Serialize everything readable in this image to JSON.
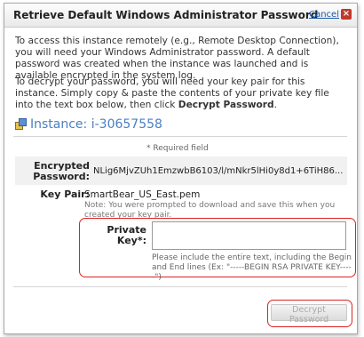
{
  "dialog": {
    "title": "Retrieve Default Windows Administrator Password",
    "cancel_label": "Cancel",
    "close_glyph": "×"
  },
  "intro": {
    "paragraph1": "To access this instance remotely (e.g., Remote Desktop Connection), you will need your Windows Administrator password. A default password was created when the instance was launched and is available encrypted in the system log.",
    "paragraph2_part1": "To decrypt your password, you will need your key pair for this instance. Simply copy & paste the contents of your private key file into the text box below, then click ",
    "paragraph2_bold": "Decrypt Password",
    "paragraph2_end": "."
  },
  "instance": {
    "label": "Instance:",
    "id": "i-30657558",
    "icon": "instance-icon"
  },
  "form": {
    "required_note": "* Required field",
    "encrypted_password_label": "Encrypted Password:",
    "encrypted_password_value": "NLig6MjvZUh1EmzwbB6103/l/mNkr5lHi0y8d1+6TiH86...",
    "key_pair_label": "Key Pair:",
    "key_pair_value": "SmartBear_US_East.pem",
    "key_pair_note": "Note: You were prompted to download and save this when you created your key pair.",
    "private_key_label": "Private Key*:",
    "private_key_value": "",
    "private_key_note": "Please include the entire text, including the Begin and End lines (Ex: \"-----BEGIN RSA PRIVATE KEY-----\")"
  },
  "actions": {
    "decrypt_label": "Decrypt Password"
  },
  "colors": {
    "highlight": "#dd2222",
    "link": "#1e5aa8",
    "instance_blue": "#4a7fc1"
  }
}
